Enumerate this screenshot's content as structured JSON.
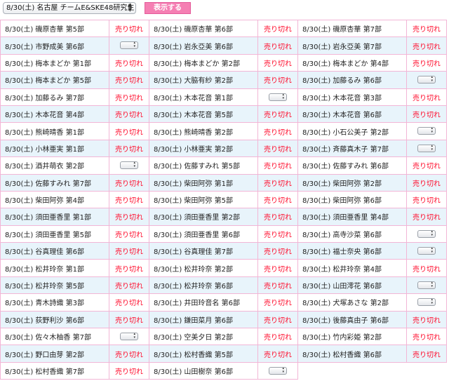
{
  "toolbar": {
    "event_select_value": "8/30(土) 名古屋 チームE&SKE48研究生",
    "show_button_label": "表示する"
  },
  "status_labels": {
    "sold_out": "売り切れ"
  },
  "rows": [
    [
      {
        "label": "8/30(土) 磯原杏華 第5部",
        "status": "sold_out"
      },
      {
        "label": "8/30(土) 磯原杏華 第6部",
        "status": "sold_out"
      },
      {
        "label": "8/30(土) 磯原杏華 第7部",
        "status": "sold_out"
      }
    ],
    [
      {
        "label": "8/30(土) 市野成美 第6部",
        "status": "select"
      },
      {
        "label": "8/30(土) 岩永亞美 第6部",
        "status": "sold_out"
      },
      {
        "label": "8/30(土) 岩永亞美 第7部",
        "status": "sold_out"
      }
    ],
    [
      {
        "label": "8/30(土) 梅本まどか 第1部",
        "status": "sold_out"
      },
      {
        "label": "8/30(土) 梅本まどか 第2部",
        "status": "sold_out"
      },
      {
        "label": "8/30(土) 梅本まどか 第4部",
        "status": "sold_out"
      }
    ],
    [
      {
        "label": "8/30(土) 梅本まどか 第5部",
        "status": "sold_out"
      },
      {
        "label": "8/30(土) 大脇有紗 第2部",
        "status": "sold_out"
      },
      {
        "label": "8/30(土) 加藤るみ 第6部",
        "status": "select"
      }
    ],
    [
      {
        "label": "8/30(土) 加藤るみ 第7部",
        "status": "sold_out"
      },
      {
        "label": "8/30(土) 木本花音 第1部",
        "status": "select"
      },
      {
        "label": "8/30(土) 木本花音 第3部",
        "status": "sold_out"
      }
    ],
    [
      {
        "label": "8/30(土) 木本花音 第4部",
        "status": "sold_out"
      },
      {
        "label": "8/30(土) 木本花音 第5部",
        "status": "sold_out"
      },
      {
        "label": "8/30(土) 木本花音 第6部",
        "status": "sold_out"
      }
    ],
    [
      {
        "label": "8/30(土) 熊崎晴香 第1部",
        "status": "sold_out"
      },
      {
        "label": "8/30(土) 熊崎晴香 第2部",
        "status": "sold_out"
      },
      {
        "label": "8/30(土) 小石公美子 第2部",
        "status": "select"
      }
    ],
    [
      {
        "label": "8/30(土) 小林亜実 第1部",
        "status": "sold_out"
      },
      {
        "label": "8/30(土) 小林亜実 第2部",
        "status": "sold_out"
      },
      {
        "label": "8/30(土) 斉藤真木子 第7部",
        "status": "select"
      }
    ],
    [
      {
        "label": "8/30(土) 酒井萌衣 第2部",
        "status": "select"
      },
      {
        "label": "8/30(土) 佐藤すみれ 第5部",
        "status": "sold_out"
      },
      {
        "label": "8/30(土) 佐藤すみれ 第6部",
        "status": "sold_out"
      }
    ],
    [
      {
        "label": "8/30(土) 佐藤すみれ 第7部",
        "status": "sold_out"
      },
      {
        "label": "8/30(土) 柴田阿弥 第1部",
        "status": "sold_out"
      },
      {
        "label": "8/30(土) 柴田阿弥 第2部",
        "status": "sold_out"
      }
    ],
    [
      {
        "label": "8/30(土) 柴田阿弥 第4部",
        "status": "sold_out"
      },
      {
        "label": "8/30(土) 柴田阿弥 第5部",
        "status": "sold_out"
      },
      {
        "label": "8/30(土) 柴田阿弥 第6部",
        "status": "sold_out"
      }
    ],
    [
      {
        "label": "8/30(土) 須田亜香里 第1部",
        "status": "sold_out"
      },
      {
        "label": "8/30(土) 須田亜香里 第2部",
        "status": "sold_out"
      },
      {
        "label": "8/30(土) 須田亜香里 第4部",
        "status": "sold_out"
      }
    ],
    [
      {
        "label": "8/30(土) 須田亜香里 第5部",
        "status": "sold_out"
      },
      {
        "label": "8/30(土) 須田亜香里 第6部",
        "status": "sold_out"
      },
      {
        "label": "8/30(土) 高寺沙菜 第6部",
        "status": "select"
      }
    ],
    [
      {
        "label": "8/30(土) 谷真理佳 第6部",
        "status": "sold_out"
      },
      {
        "label": "8/30(土) 谷真理佳 第7部",
        "status": "sold_out"
      },
      {
        "label": "8/30(土) 福士奈央 第6部",
        "status": "select"
      }
    ],
    [
      {
        "label": "8/30(土) 松井玲奈 第1部",
        "status": "sold_out"
      },
      {
        "label": "8/30(土) 松井玲奈 第2部",
        "status": "sold_out"
      },
      {
        "label": "8/30(土) 松井玲奈 第4部",
        "status": "sold_out"
      }
    ],
    [
      {
        "label": "8/30(土) 松井玲奈 第5部",
        "status": "sold_out"
      },
      {
        "label": "8/30(土) 松井玲奈 第6部",
        "status": "sold_out"
      },
      {
        "label": "8/30(土) 山田澪花 第6部",
        "status": "select"
      }
    ],
    [
      {
        "label": "8/30(土) 青木詩織 第3部",
        "status": "sold_out"
      },
      {
        "label": "8/30(土) 井田玲音名 第6部",
        "status": "sold_out"
      },
      {
        "label": "8/30(土) 犬塚あさな 第2部",
        "status": "select"
      }
    ],
    [
      {
        "label": "8/30(土) 荻野利沙 第6部",
        "status": "sold_out"
      },
      {
        "label": "8/30(土) 鎌田菜月 第6部",
        "status": "sold_out"
      },
      {
        "label": "8/30(土) 後藤真由子 第6部",
        "status": "sold_out"
      }
    ],
    [
      {
        "label": "8/30(土) 佐々木柚香 第7部",
        "status": "select"
      },
      {
        "label": "8/30(土) 空美夕日 第2部",
        "status": "sold_out"
      },
      {
        "label": "8/30(土) 竹内彩姫 第2部",
        "status": "sold_out"
      }
    ],
    [
      {
        "label": "8/30(土) 野口由芽 第2部",
        "status": "sold_out"
      },
      {
        "label": "8/30(土) 松村香織 第5部",
        "status": "sold_out"
      },
      {
        "label": "8/30(土) 松村香織 第6部",
        "status": "sold_out"
      }
    ],
    [
      {
        "label": "8/30(土) 松村香織 第7部",
        "status": "sold_out"
      },
      {
        "label": "8/30(土) 山田樹奈 第6部",
        "status": "select"
      },
      null
    ]
  ]
}
